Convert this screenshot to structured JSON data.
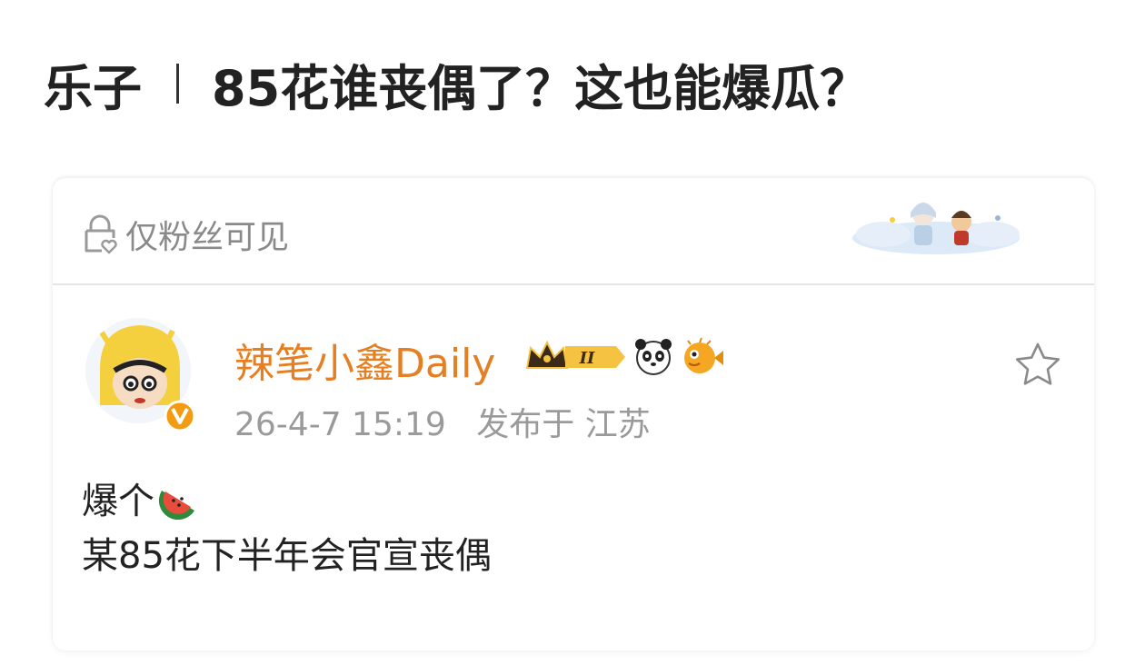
{
  "headline": {
    "category": "乐子",
    "title": "85花谁丧偶了？这也能爆瓜？"
  },
  "card": {
    "visibility_label": "仅粉丝可见",
    "visibility_icon": "lock-heart-icon",
    "sticker_icon": "character-sticker-icon",
    "post": {
      "author_name": "辣笔小鑫Daily",
      "author_color": "#e67e22",
      "verified_icon": "verified-v-icon",
      "badges": [
        "crown-level-badge-icon",
        "panda-icon",
        "pufferfish-icon"
      ],
      "level_label": "II",
      "date": "26-4-7 15:19",
      "location": "发布于 江苏",
      "favorite_icon": "star-icon",
      "lines": [
        {
          "text": "爆个",
          "emoji": "watermelon-icon"
        },
        {
          "text": "某85花下半年会官宣丧偶"
        }
      ]
    }
  }
}
